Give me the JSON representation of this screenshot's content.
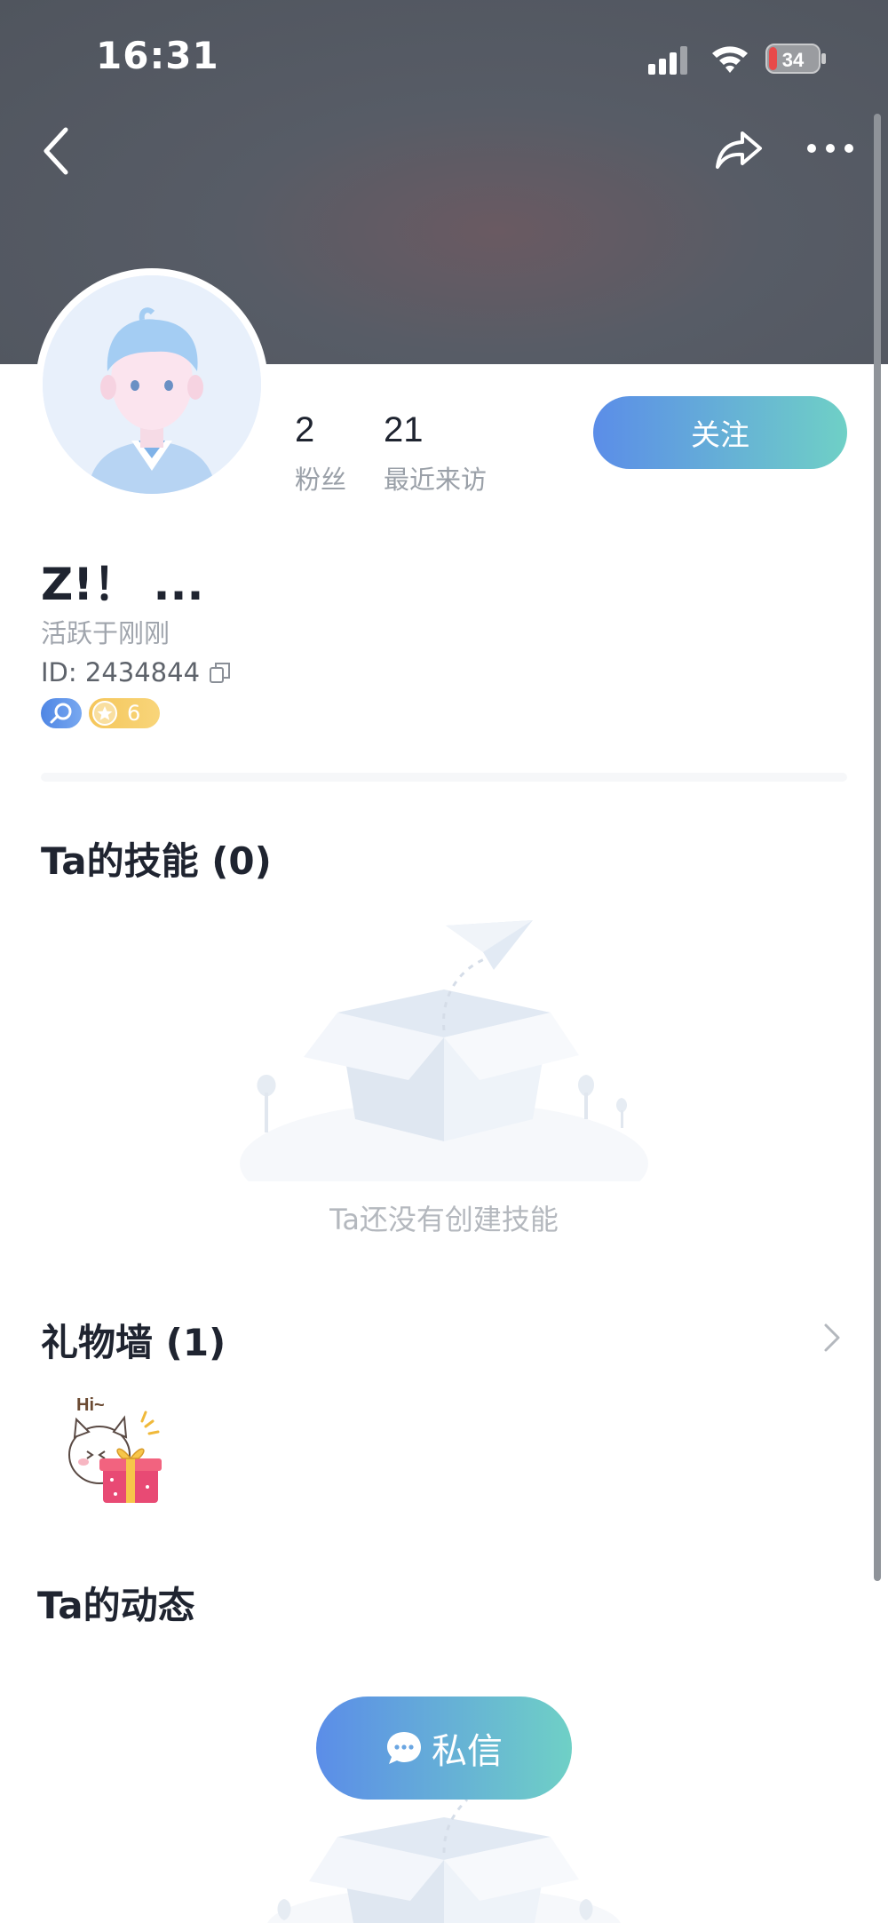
{
  "status_bar": {
    "time": "16:31",
    "battery": "34"
  },
  "colors": {
    "accent_start": "#5b8de8",
    "accent_end": "#6fd0c6",
    "header_bg": "#53575f"
  },
  "nav": {
    "back_icon": "back-chevron-icon",
    "share_icon": "share-icon",
    "more_icon": "more-dots-icon"
  },
  "profile": {
    "stats": [
      {
        "value": "2",
        "label": "粉丝"
      },
      {
        "value": "21",
        "label": "最近来访"
      }
    ],
    "follow_label": "关注",
    "name": "Z!！ ...",
    "active": "活跃于刚刚",
    "id": "ID: 2434844",
    "level": "6"
  },
  "skills": {
    "title": "Ta的技能 (0)",
    "empty_text": "Ta还没有创建技能"
  },
  "gifts": {
    "title": "礼物墙 (1)",
    "gift_text": "Hi~"
  },
  "moments": {
    "title": "Ta的动态"
  },
  "dm_label": "私信"
}
